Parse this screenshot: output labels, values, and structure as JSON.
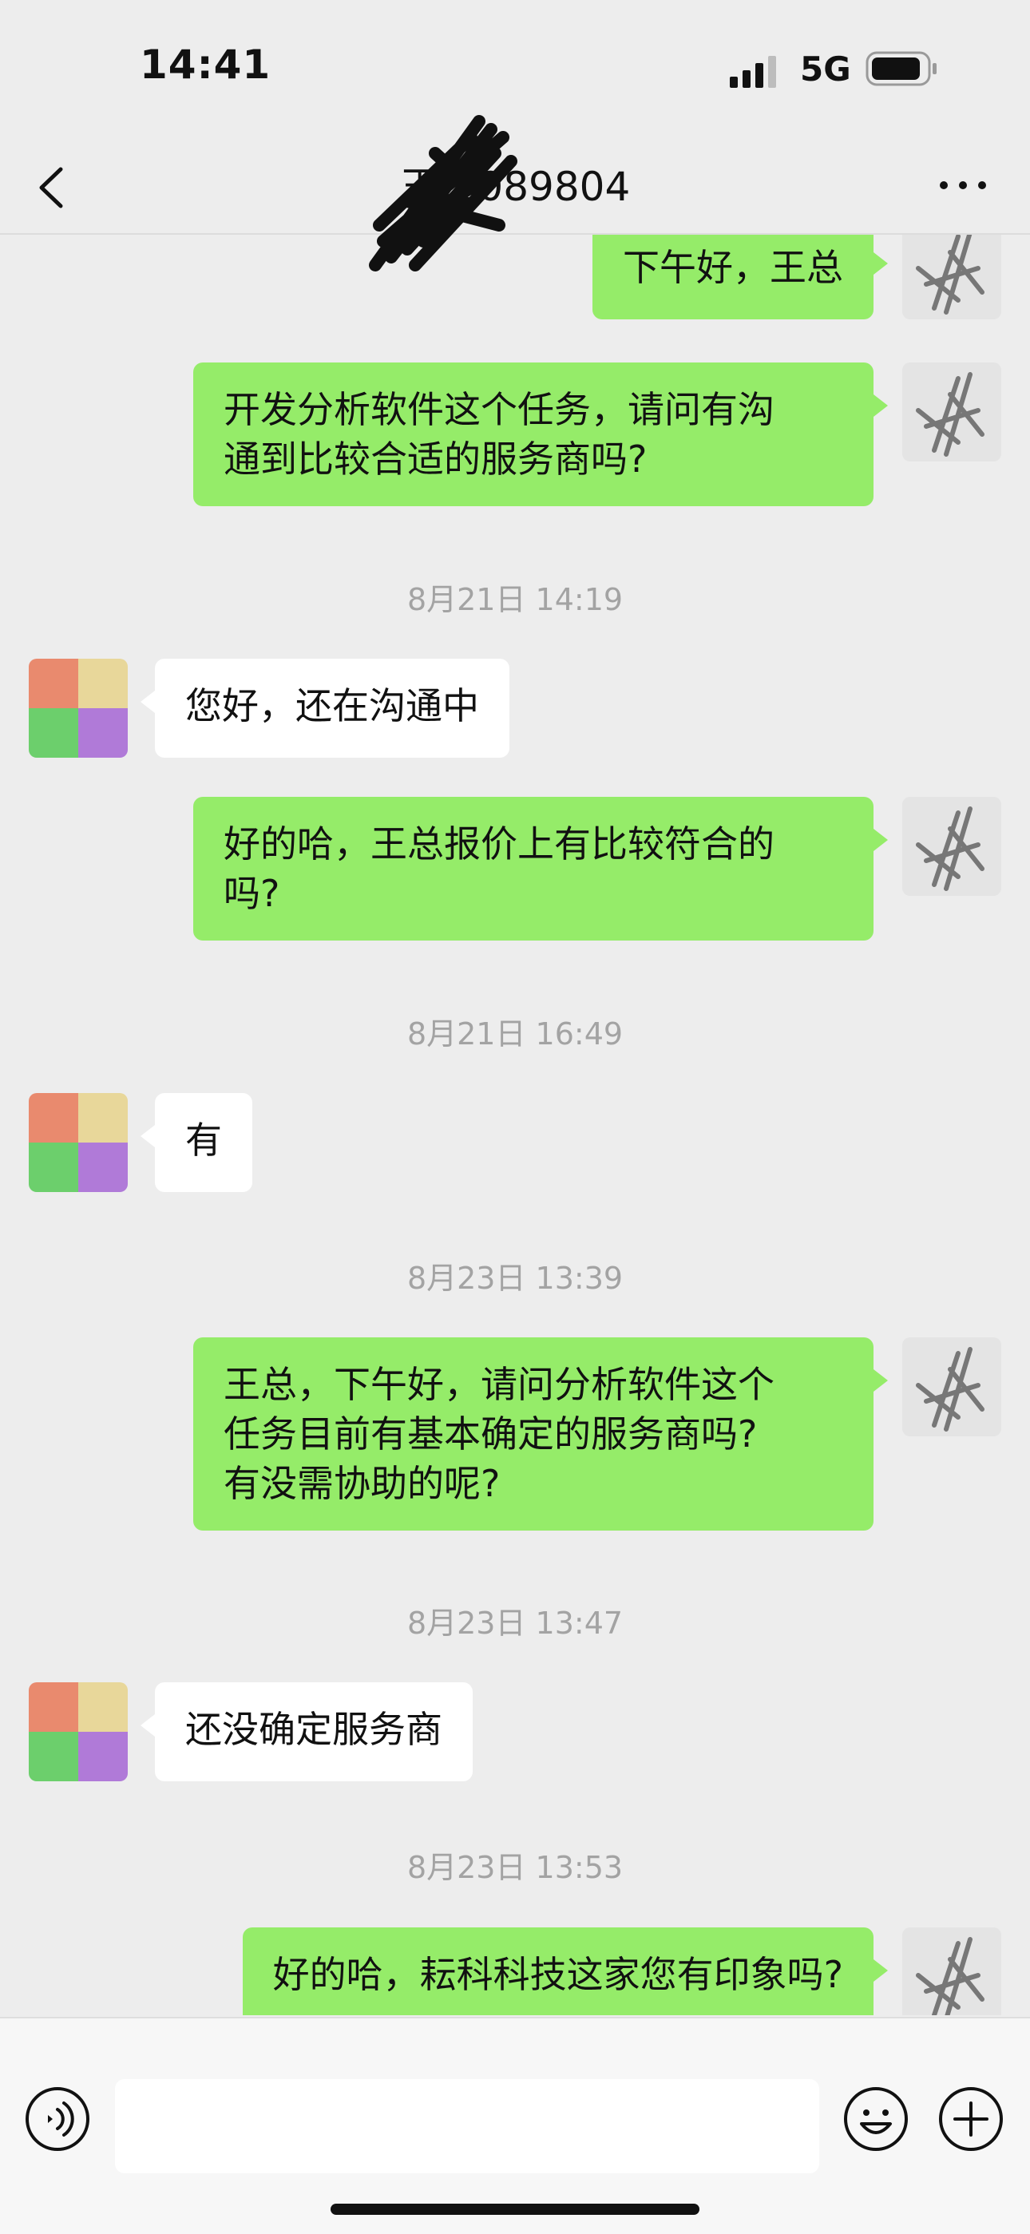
{
  "status": {
    "time": "14:41",
    "network": "5G"
  },
  "header": {
    "title": "王    1089804"
  },
  "messages": [
    {
      "type": "out",
      "text": "下午好，王总"
    },
    {
      "type": "out",
      "text": "开发分析软件这个任务，请问有沟\n通到比较合适的服务商吗?"
    },
    {
      "type": "time",
      "text": "8月21日 14:19"
    },
    {
      "type": "in",
      "text": "您好，还在沟通中"
    },
    {
      "type": "out",
      "text": "好的哈，王总报价上有比较符合的\n吗?"
    },
    {
      "type": "time",
      "text": "8月21日 16:49"
    },
    {
      "type": "in",
      "text": "有"
    },
    {
      "type": "time",
      "text": "8月23日 13:39"
    },
    {
      "type": "out",
      "text": "王总，下午好，请问分析软件这个\n任务目前有基本确定的服务商吗?\n有没需协助的呢?"
    },
    {
      "type": "time",
      "text": "8月23日 13:47"
    },
    {
      "type": "in",
      "text": "还没确定服务商"
    },
    {
      "type": "time",
      "text": "8月23日 13:53"
    },
    {
      "type": "out",
      "text": "好的哈，耘科科技这家您有印象吗?"
    }
  ],
  "input": {
    "value": ""
  },
  "icons": {
    "back": "chevron-left-icon",
    "more": "more-dots-icon",
    "voice": "voice-icon",
    "emoji": "emoji-icon",
    "plus": "plus-icon"
  },
  "colors": {
    "outgoing_bubble": "#95ec69",
    "incoming_bubble": "#ffffff",
    "background": "#ededed"
  }
}
